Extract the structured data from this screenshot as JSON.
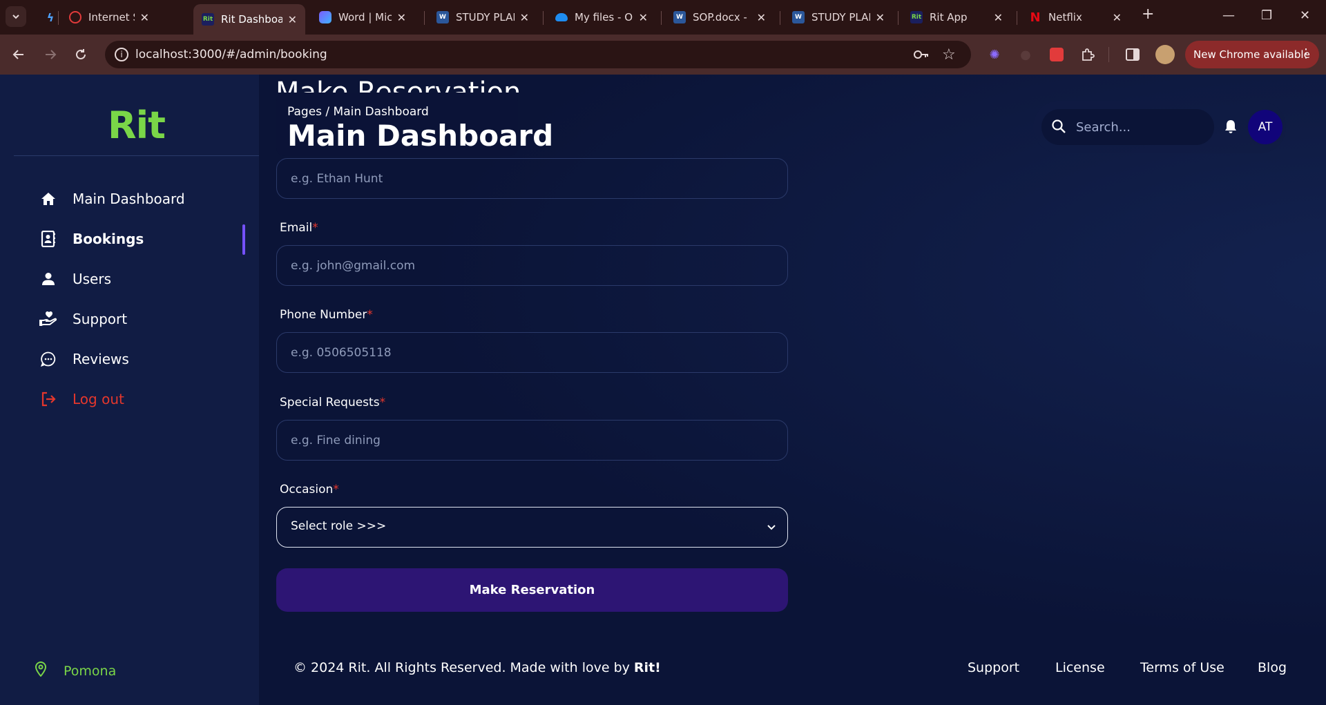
{
  "browser": {
    "tabs": [
      {
        "title": "",
        "icon": "tool-favicon"
      },
      {
        "title": "Internet Spe",
        "icon": "speedtest-favicon"
      },
      {
        "title": "Rit Dashboa",
        "icon": "rit-favicon",
        "active": true
      },
      {
        "title": "Word | Micro",
        "icon": "copilot-favicon"
      },
      {
        "title": "STUDY PLAN",
        "icon": "word-favicon"
      },
      {
        "title": "My files - On",
        "icon": "onedrive-favicon"
      },
      {
        "title": "SOP.docx - M",
        "icon": "word-favicon"
      },
      {
        "title": "STUDY PLAN",
        "icon": "word-favicon"
      },
      {
        "title": "Rit App",
        "icon": "rit-favicon"
      },
      {
        "title": "Netflix",
        "icon": "netflix-favicon"
      }
    ],
    "rit_favicon_text": "Rit",
    "word_favicon_text": "W",
    "netflix_favicon_text": "N",
    "url": "localhost:3000/#/admin/booking",
    "update_label": "New Chrome available"
  },
  "sidebar": {
    "logo": "Rit",
    "items": [
      {
        "label": "Main Dashboard",
        "icon": "home-icon"
      },
      {
        "label": "Bookings",
        "icon": "contact-book-icon",
        "active": true
      },
      {
        "label": "Users",
        "icon": "user-icon"
      },
      {
        "label": "Support",
        "icon": "hand-heart-icon"
      },
      {
        "label": "Reviews",
        "icon": "chat-bubble-icon"
      },
      {
        "label": "Log out",
        "icon": "logout-icon"
      }
    ],
    "location": "Pomona"
  },
  "header": {
    "underlying_title": "Make Reservation",
    "breadcrumb": "Pages  /  Main Dashboard",
    "title": "Main Dashboard",
    "search_placeholder": "Search...",
    "avatar_initials": "AT"
  },
  "form": {
    "name_placeholder": "e.g. Ethan Hunt",
    "email_label": "Email",
    "email_placeholder": "e.g. john@gmail.com",
    "phone_label": "Phone Number",
    "phone_placeholder": "e.g. 0506505118",
    "requests_label": "Special Requests",
    "requests_placeholder": "e.g. Fine dining",
    "occasion_label": "Occasion",
    "occasion_value": "Select role >>>",
    "required_mark": "*",
    "submit_label": "Make Reservation"
  },
  "footer": {
    "copyright": "© 2024 Rit. All Rights Reserved. Made with love by",
    "copyright_brand": "Rit!",
    "links": [
      "Support",
      "License",
      "Terms of Use",
      "Blog"
    ]
  },
  "colors": {
    "brand_green": "#7ad648",
    "accent_purple": "#7551ff",
    "danger_red": "#e5372c",
    "page_bg": "#0b1437",
    "sidebar_bg": "#111c44"
  }
}
